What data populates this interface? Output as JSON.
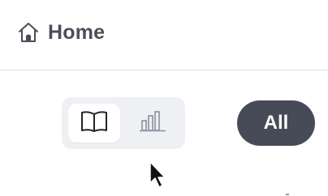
{
  "header": {
    "home_icon": "home-icon",
    "home_label": "Home"
  },
  "view_toggle": {
    "options": [
      {
        "icon": "book-icon",
        "selected": true
      },
      {
        "icon": "bar-chart-icon",
        "selected": false
      }
    ]
  },
  "filter": {
    "all_label": "All"
  },
  "colors": {
    "text_dark": "#4a4e58",
    "pill_bg": "#474b57",
    "toggle_bg": "#eff0f4",
    "divider": "#e2e3e6",
    "chart_icon": "#8d909c"
  }
}
